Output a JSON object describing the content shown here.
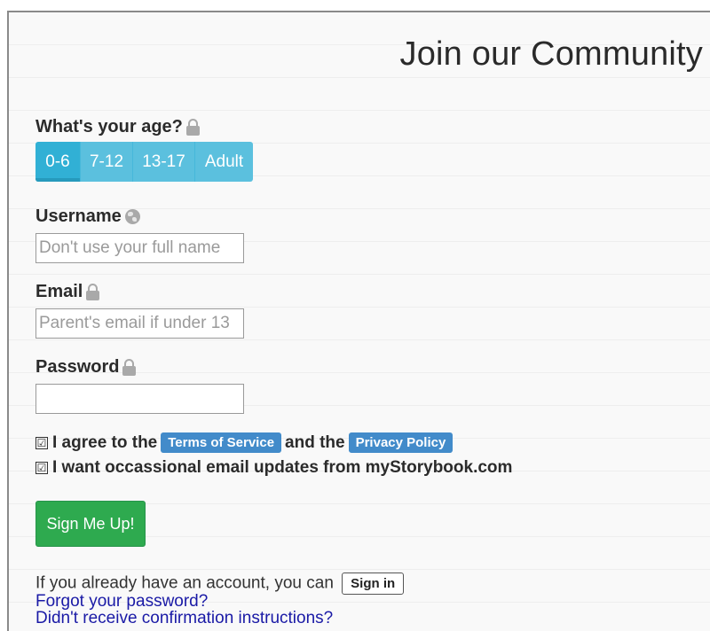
{
  "header": {
    "title": "Join our Community"
  },
  "age": {
    "label": "What's your age?",
    "options": [
      "0-6",
      "7-12",
      "13-17",
      "Adult"
    ],
    "selected": "0-6"
  },
  "username": {
    "label": "Username",
    "placeholder": "Don't use your full name",
    "value": ""
  },
  "email": {
    "label": "Email",
    "placeholder": "Parent's email if under 13",
    "value": ""
  },
  "password": {
    "label": "Password",
    "value": ""
  },
  "agreements": {
    "terms_prefix": "I agree to the",
    "terms_link": "Terms of Service",
    "terms_middle": "and the",
    "privacy_link": "Privacy Policy",
    "updates": "I want occassional email updates from myStorybook.com",
    "check_mark": "☑"
  },
  "signup_button": "Sign Me Up!",
  "footer": {
    "account_text": "If you already have an account, you can",
    "signin_button": "Sign in",
    "forgot_link": "Forgot your password?",
    "confirm_link": "Didn't receive confirmation instructions?"
  },
  "colors": {
    "age_active": "#31b0d5",
    "age_default": "#5bc0de",
    "pill_blue": "#428bca",
    "signup_green": "#2eaa4f"
  }
}
